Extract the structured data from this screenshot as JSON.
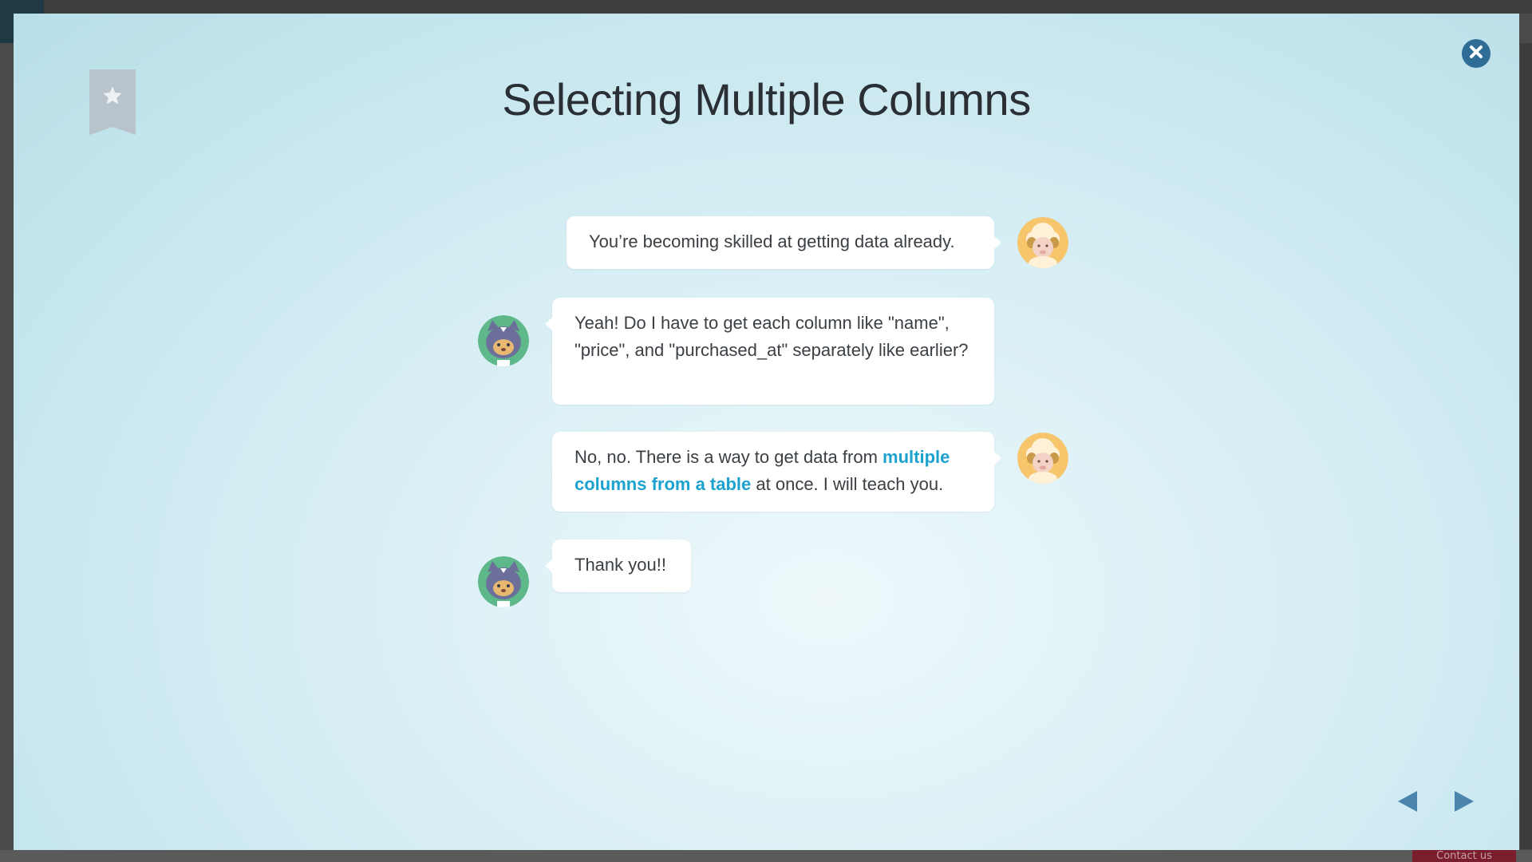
{
  "background": {
    "contact_label": "Contact us"
  },
  "modal": {
    "title": "Selecting Multiple Columns",
    "colors": {
      "accent": "#1ba2cf",
      "close_button": "#2f6d96",
      "nav_arrow": "#4a84ad",
      "bookmark": "#b8c3cc"
    },
    "icons": {
      "bookmark": "bookmark-star-icon",
      "close": "close-icon",
      "prev": "arrow-left-icon",
      "next": "arrow-right-icon",
      "sheep": "sheep-avatar",
      "cat": "cat-avatar"
    },
    "messages": [
      {
        "speaker": "sheep",
        "text": "You’re becoming skilled at getting data already."
      },
      {
        "speaker": "cat",
        "text": "Yeah! Do I have to get each column like \"name\", \"price\", and \"purchased_at\" separately like earlier?"
      },
      {
        "speaker": "sheep",
        "text_before": "No, no. There is a way to get data from ",
        "highlight": "multiple columns from a table",
        "text_after": " at once. I will teach you."
      },
      {
        "speaker": "cat",
        "text": "Thank you!!"
      }
    ]
  }
}
